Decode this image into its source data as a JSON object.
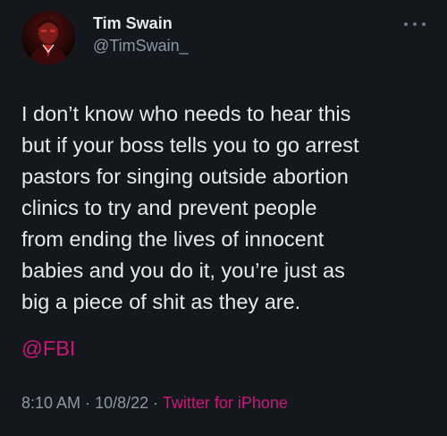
{
  "author": {
    "display_name": "Tim Swain",
    "handle": "@TimSwain_"
  },
  "tweet": {
    "text": "I don’t know who needs to hear this\nbut if your boss tells you to go arrest\npastors for singing outside abortion\nclinics to try and prevent people\nfrom ending the lives of innocent\nbabies and you do it, you’re just as\nbig a piece of shit as they are.",
    "mention": "@FBI",
    "time": "8:10 AM",
    "separator": "·",
    "date": "10/8/22",
    "source": "Twitter for iPhone"
  },
  "icons": {
    "more": "more-horizontal-icon"
  },
  "colors": {
    "background": "#14171c",
    "text": "#e7e9ea",
    "secondary": "#8b98a5",
    "accent": "#c9187a"
  }
}
